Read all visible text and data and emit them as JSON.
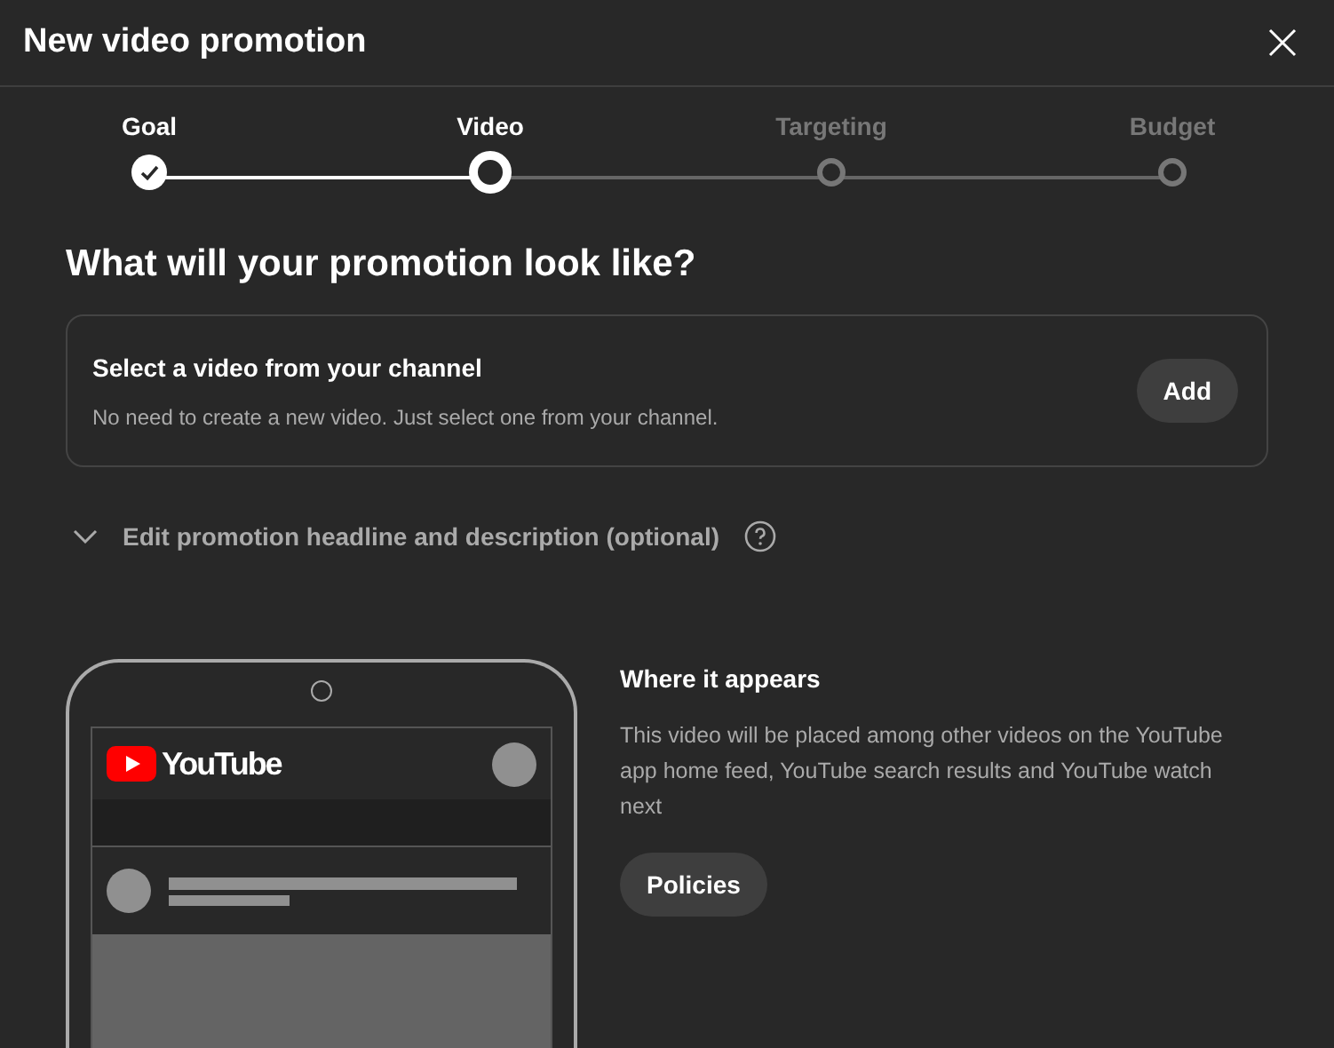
{
  "dialog": {
    "title": "New video promotion"
  },
  "steps": [
    {
      "label": "Goal",
      "completed": true,
      "selected": false
    },
    {
      "label": "Video",
      "completed": false,
      "selected": true
    },
    {
      "label": "Targeting",
      "completed": false,
      "selected": false
    },
    {
      "label": "Budget",
      "completed": false,
      "selected": false
    }
  ],
  "heading": "What will your promotion look like?",
  "video_card": {
    "title": "Select a video from your channel",
    "description": "No need to create a new video. Just select one from your channel.",
    "button": "Add"
  },
  "expander": {
    "label": "Edit promotion headline and description (optional)"
  },
  "preview": {
    "logo_text": "YouTube",
    "title": "Where it appears",
    "description": "This video will be placed among other videos on the YouTube app home feed, YouTube search results and YouTube watch next",
    "button": "Policies"
  }
}
